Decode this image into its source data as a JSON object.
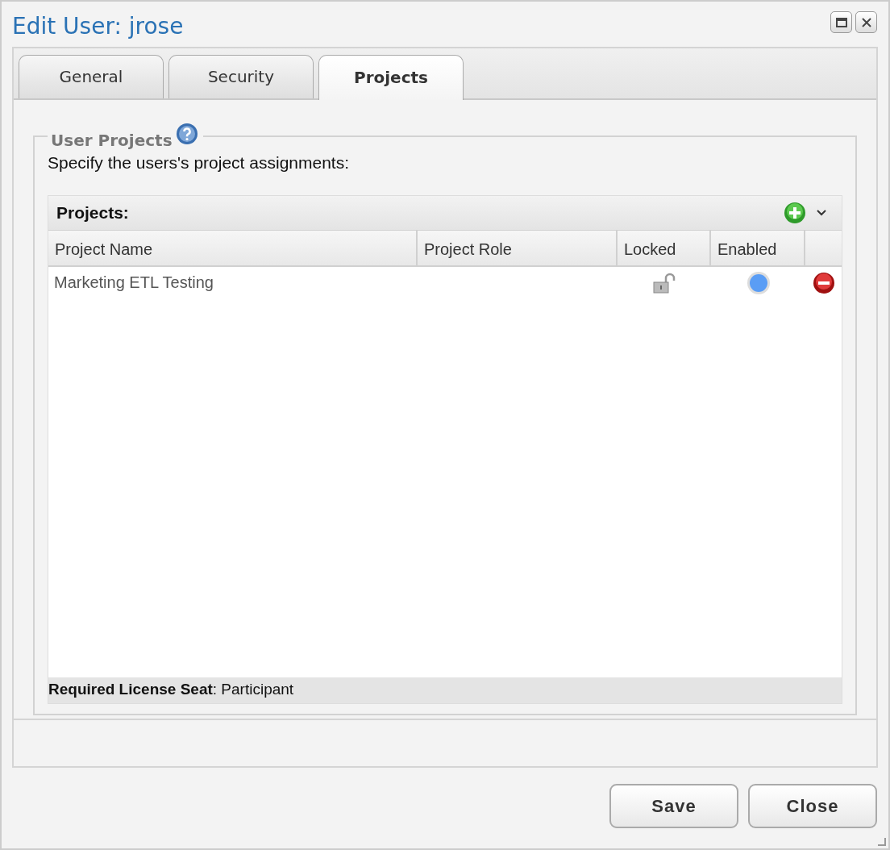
{
  "window": {
    "title": "Edit User: jrose"
  },
  "tabs": [
    {
      "label": "General",
      "selected": false
    },
    {
      "label": "Security",
      "selected": false
    },
    {
      "label": "Projects",
      "selected": true
    }
  ],
  "section": {
    "legend": "User Projects",
    "description": "Specify the users's project assignments:"
  },
  "grid": {
    "title": "Projects:",
    "columns": [
      "Project Name",
      "Project Role",
      "Locked",
      "Enabled"
    ],
    "rows": [
      {
        "project_name": "Marketing ETL Testing",
        "project_role": "",
        "locked": false,
        "enabled": true
      }
    ],
    "footer": "**Required License Seat**: Participant"
  },
  "buttons": [
    "Save",
    "Close"
  ]
}
